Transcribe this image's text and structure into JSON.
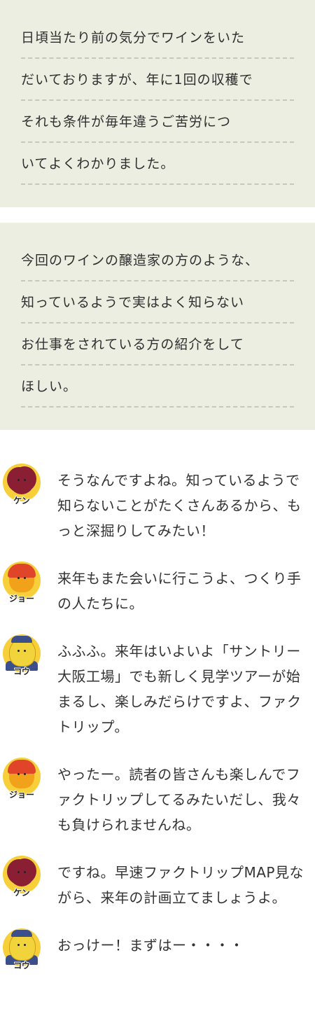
{
  "comments": [
    {
      "lines": [
        "日頃当たり前の気分でワインをいた",
        "だいておりますが、年に1回の収穫で",
        "それも条件が毎年違うご苦労につ",
        "いてよくわかりました。"
      ]
    },
    {
      "lines": [
        "今回のワインの醸造家の方のような、",
        "知っているようで実はよく知らない",
        "お仕事をされている方の紹介をして",
        "ほしい。"
      ]
    }
  ],
  "chat": [
    {
      "speaker": "ケン",
      "icon": "ken-avatar-icon",
      "text": "そうなんですよね。知っているようで知らないことがたくさんあるから、もっと深掘りしてみたい！"
    },
    {
      "speaker": "ジョー",
      "icon": "jo-avatar-icon",
      "text": "来年もまた会いに行こうよ、つくり手の人たちに。"
    },
    {
      "speaker": "コウ",
      "icon": "ko-avatar-icon",
      "text": "ふふふ。来年はいよいよ「サントリー大阪工場」でも新しく見学ツアーが始まるし、楽しみだらけですよ、ファクトリップ。"
    },
    {
      "speaker": "ジョー",
      "icon": "jo-avatar-icon",
      "text": "やったー。読者の皆さんも楽しんでファクトリップしてるみたいだし、我々も負けられませんね。"
    },
    {
      "speaker": "ケン",
      "icon": "ken-avatar-icon",
      "text": "ですね。早速ファクトリップMAP見ながら、来年の計画立てましょうよ。"
    },
    {
      "speaker": "コウ",
      "icon": "ko-avatar-icon",
      "text": "おっけー！まずはー・・・・"
    }
  ],
  "colors": {
    "card_bg": "#ebeee1",
    "avatar_circle": "#f6cf3a",
    "ken": "#8a1f33",
    "jo_hat": "#e0452a",
    "ko_cap": "#3b4f8a"
  }
}
